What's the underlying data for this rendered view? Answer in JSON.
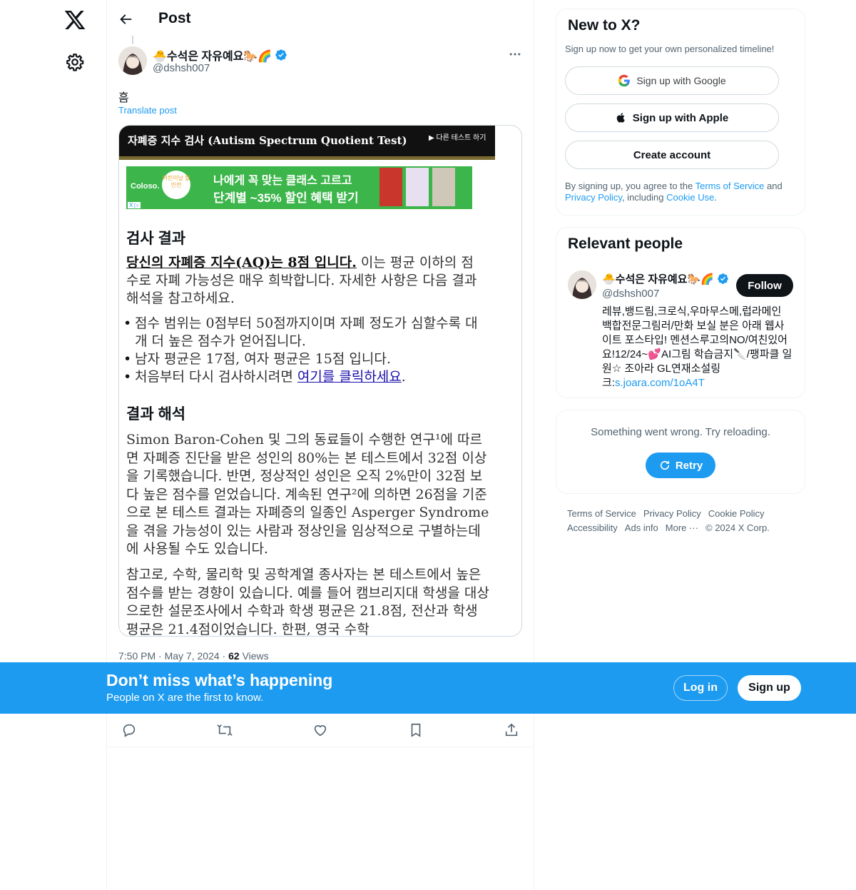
{
  "nav": {
    "logo_icon": "x-logo-icon",
    "settings_icon": "gear-icon"
  },
  "header": {
    "title": "Post"
  },
  "post": {
    "author_name": "🐣수석은 자유예요🐎🌈",
    "author_handle": "@dshsh007",
    "text": "흠",
    "translate_label": "Translate post",
    "time": "7:50 PM",
    "date": "May 7, 2024",
    "views_count": "62",
    "views_label": "Views",
    "media": {
      "header_title": "자폐증 지수 검사 (Autism Spectrum Quotient Test)",
      "header_link": "▶ 다른 테스트 하기",
      "ad_brand": "Coloso.",
      "ad_badge": "어린이날 할인전",
      "ad_line1": "나에게 꼭 맞는 클래스 고르고",
      "ad_line2": "단계별 ~35% 할인 혜택 받기",
      "ad_indicator": "X ▷",
      "section1_title": "검사 결과",
      "result_bold": "당신의 자폐증 지수(AQ)는 8점 입니다.",
      "result_rest": " 이는 평균 이하의 점수로 자폐 가능성은 매우 희박합니다. 자세한 사항은 다음 결과 해석을 참고하세요.",
      "bullet1": "점수 범위는 0점부터 50점까지이며 자폐 정도가 심할수록 대개 더 높은 점수가 얻어집니다.",
      "bullet2": "남자 평균은 17점, 여자 평균은 15점 입니다.",
      "bullet3_pre": "처음부터 다시 검사하시려면 ",
      "bullet3_link": "여기를 클릭하세요",
      "bullet3_post": ".",
      "section2_title": "결과 해석",
      "para2": "Simon Baron-Cohen 및 그의 동료들이 수행한 연구¹에 따르면 자폐증 진단을 받은 성인의 80%는 본 테스트에서 32점 이상을 기록했습니다. 반면, 정상적인 성인은 오직 2%만이 32점 보다 높은 점수를 얻었습니다. 계속된 연구²에 의하면 26점을 기준으로 본 테스트 결과는 자폐증의 일종인 Asperger Syndrome을 겪을 가능성이 있는 사람과 정상인을 임상적으로 구별하는데에 사용될 수도 있습니다.",
      "para3": "참고로, 수학, 물리학 및 공학계열 종사자는 본 테스트에서 높은 점수를 받는 경향이 있습니다. 예를 들어 캠브리지대 학생을 대상으로한 설문조사에서 수학과 학생 평균은 21.8점, 전산과 학생 평균은 21.4점이었습니다. 한편, 영국 수학"
    }
  },
  "sidebar": {
    "new": {
      "title": "New to X?",
      "subtitle": "Sign up now to get your own personalized timeline!",
      "google_label": "Sign up with Google",
      "apple_label": "Sign up with Apple",
      "create_label": "Create account",
      "terms_pre": "By signing up, you agree to the ",
      "terms_tos": "Terms of Service",
      "terms_and": " and ",
      "terms_privacy": "Privacy Policy",
      "terms_incl": ", including ",
      "terms_cookie": "Cookie Use",
      "terms_end": "."
    },
    "people": {
      "title": "Relevant people",
      "name": "🐣수석은 자유예요🐎🌈",
      "handle": "@dshsh007",
      "follow_label": "Follow",
      "bio": "레뷰,뱅드림,크로식,우마무스메,럽라메인 백합전문그림러/만화 보실 분은 아래 웹사이트 포스타입! 멘션스루고의NO/여친있어요!12/24~💕AI그림 학습금지🔪/팽파클 일원☆ 조아라 GL연재소설링크:",
      "bio_link": "s.joara.com/1oA4T"
    },
    "error": {
      "message": "Something went wrong. Try reloading.",
      "retry_label": "Retry"
    },
    "footer": {
      "terms": "Terms of Service",
      "privacy": "Privacy Policy",
      "cookie": "Cookie Policy",
      "accessibility": "Accessibility",
      "ads": "Ads info",
      "more": "More ···",
      "copyright": "© 2024 X Corp."
    }
  },
  "banner": {
    "title": "Don’t miss what’s happening",
    "subtitle": "People on X are the first to know.",
    "login_label": "Log in",
    "signup_label": "Sign up"
  },
  "colors": {
    "accent": "#1d9bf0",
    "text": "#0f1419",
    "muted": "#536471"
  }
}
